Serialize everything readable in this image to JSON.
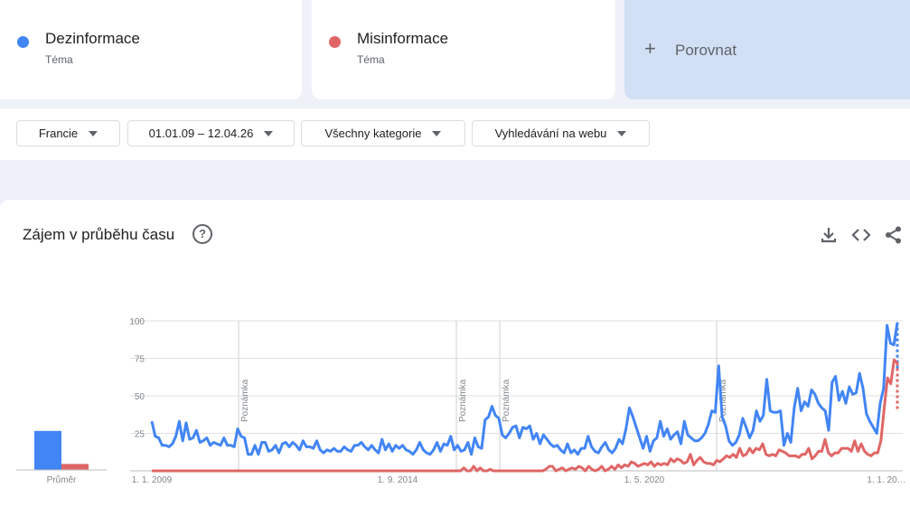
{
  "terms": [
    {
      "name": "Dezinformace",
      "type": "Téma",
      "color": "#4285f4"
    },
    {
      "name": "Misinformace",
      "type": "Téma",
      "color": "#e06666"
    }
  ],
  "compare": {
    "label": "Porovnat"
  },
  "filters": {
    "region": "Francie",
    "date_range": "01.01.09 – 12.04.26",
    "category": "Všechny kategorie",
    "search_type": "Vyhledávání na webu"
  },
  "chart_section": {
    "title": "Zájem v průběhu času",
    "average_label": "Průměr",
    "note_label": "Poznámka"
  },
  "chart_data": {
    "type": "line",
    "x_tick_labels": [
      "1. 1. 2009",
      "1. 9. 2014",
      "1. 5. 2020",
      "1. 1. 20…"
    ],
    "ylim": [
      0,
      100
    ],
    "y_ticks": [
      25,
      50,
      75,
      100
    ],
    "grid": true,
    "annotations": [
      "Poznámka",
      "Poznámka",
      "Poznámka",
      "Poznámka"
    ],
    "average": {
      "Dezinformace": 26,
      "Misinformace": 4
    },
    "series": [
      {
        "name": "Dezinformace",
        "color": "#4285f4",
        "values": [
          33,
          23,
          22,
          17,
          17,
          16,
          18,
          23,
          33,
          20,
          32,
          21,
          22,
          27,
          19,
          20,
          22,
          17,
          19,
          18,
          17,
          22,
          17,
          17,
          16,
          28,
          23,
          22,
          11,
          11,
          17,
          11,
          19,
          19,
          13,
          14,
          17,
          12,
          18,
          19,
          16,
          19,
          17,
          14,
          20,
          16,
          16,
          15,
          20,
          14,
          12,
          14,
          13,
          15,
          13,
          13,
          16,
          14,
          13,
          17,
          17,
          19,
          16,
          14,
          17,
          14,
          12,
          21,
          14,
          18,
          13,
          17,
          15,
          17,
          14,
          13,
          11,
          14,
          19,
          14,
          12,
          11,
          14,
          19,
          13,
          18,
          17,
          23,
          14,
          17,
          13,
          14,
          19,
          11,
          22,
          16,
          15,
          34,
          36,
          43,
          37,
          35,
          24,
          22,
          25,
          29,
          30,
          22,
          29,
          28,
          30,
          21,
          25,
          18,
          24,
          21,
          18,
          16,
          17,
          14,
          12,
          18,
          12,
          14,
          11,
          15,
          15,
          23,
          16,
          13,
          12,
          16,
          19,
          14,
          12,
          15,
          21,
          18,
          28,
          42,
          36,
          29,
          22,
          15,
          23,
          13,
          20,
          22,
          33,
          23,
          28,
          21,
          24,
          26,
          18,
          33,
          24,
          22,
          20,
          20,
          22,
          25,
          31,
          40,
          39,
          70,
          36,
          30,
          20,
          17,
          19,
          24,
          35,
          29,
          22,
          27,
          40,
          33,
          37,
          61,
          40,
          39,
          39,
          40,
          17,
          25,
          19,
          42,
          55,
          40,
          46,
          43,
          54,
          51,
          45,
          42,
          40,
          27,
          59,
          63,
          47,
          53,
          45,
          56,
          51,
          52,
          65,
          55,
          38,
          33,
          29,
          25,
          45,
          55,
          97,
          85,
          84,
          99
        ],
        "projection": [
          99,
          68
        ]
      },
      {
        "name": "Misinformace",
        "color": "#e06666",
        "values": [
          0,
          0,
          0,
          0,
          0,
          0,
          0,
          0,
          0,
          0,
          0,
          0,
          0,
          0,
          0,
          0,
          0,
          0,
          0,
          0,
          0,
          0,
          0,
          0,
          0,
          0,
          0,
          0,
          0,
          0,
          0,
          0,
          0,
          0,
          0,
          0,
          0,
          0,
          0,
          0,
          0,
          0,
          0,
          0,
          0,
          0,
          0,
          0,
          0,
          0,
          0,
          0,
          0,
          0,
          0,
          0,
          0,
          0,
          0,
          0,
          0,
          0,
          0,
          0,
          0,
          0,
          0,
          0,
          0,
          0,
          0,
          0,
          0,
          0,
          0,
          0,
          0,
          0,
          0,
          0,
          0,
          0,
          0,
          0,
          0,
          0,
          0,
          0,
          0,
          0,
          0,
          0,
          0,
          0,
          0,
          2,
          0,
          0,
          3,
          0,
          2,
          0,
          0,
          1,
          0,
          0,
          0,
          0,
          0,
          0,
          0,
          0,
          0,
          0,
          0,
          0,
          0,
          0,
          0,
          0,
          1,
          3,
          3,
          0,
          1,
          2,
          0,
          1,
          2,
          1,
          3,
          2,
          0,
          3,
          1,
          0,
          1,
          3,
          0,
          1,
          3,
          1,
          4,
          2,
          4,
          3,
          6,
          5,
          3,
          4,
          5,
          4,
          6,
          3,
          5,
          4,
          5,
          4,
          8,
          6,
          8,
          7,
          5,
          6,
          11,
          4,
          7,
          9,
          6,
          5,
          5,
          4,
          7,
          6,
          8,
          10,
          9,
          11,
          9,
          15,
          10,
          11,
          15,
          12,
          15,
          14,
          18,
          11,
          10,
          11,
          10,
          14,
          13,
          12,
          10,
          10,
          10,
          9,
          11,
          11,
          15,
          8,
          10,
          13,
          13,
          21,
          12,
          10,
          12,
          12,
          15,
          15,
          15,
          13,
          20,
          13,
          18,
          13,
          11,
          10,
          12,
          12,
          20,
          42,
          62,
          58,
          74,
          72
        ],
        "projection": [
          72,
          40
        ]
      }
    ]
  }
}
